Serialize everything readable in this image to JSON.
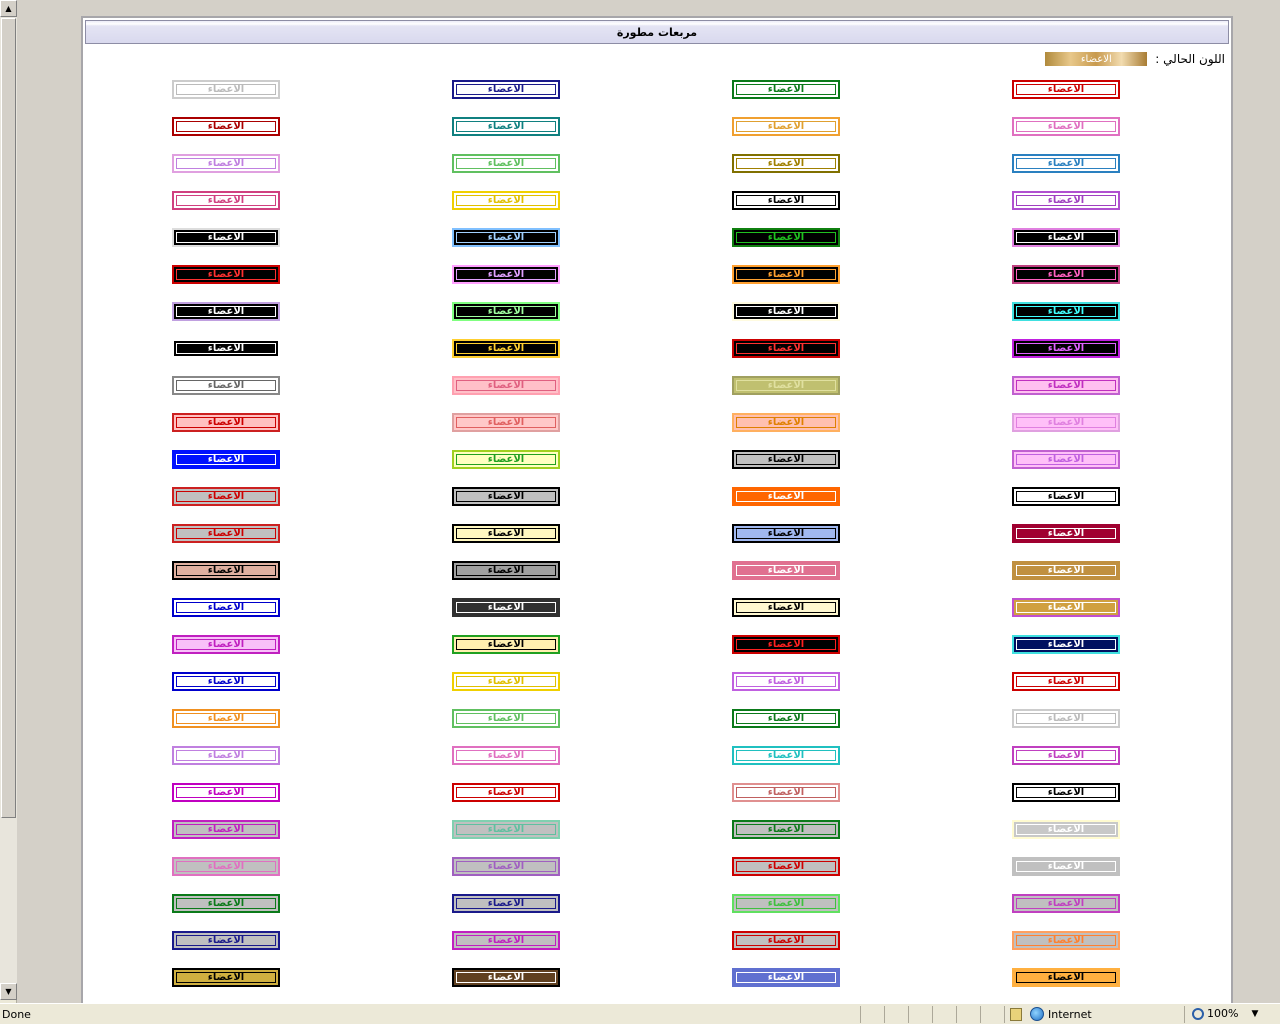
{
  "panel": {
    "title": "مربعات مطورة"
  },
  "current_color": {
    "label": "اللون الحالي :",
    "swatch_text": "الاعضاء"
  },
  "box_label": "الاعضاء",
  "columns_fg": [
    "#cc0000",
    "#0b7a1a",
    "#1a1a8a",
    "#bbbbbb"
  ],
  "rows": [
    [
      {
        "fg": "#cc0000",
        "bg": "#ffffff",
        "bd": "#cc0000"
      },
      {
        "fg": "#0b7a1a",
        "bg": "#ffffff",
        "bd": "#0b7a1a"
      },
      {
        "fg": "#1a1a8a",
        "bg": "#ffffff",
        "bd": "#1a1a8a"
      },
      {
        "fg": "#bbbbbb",
        "bg": "#ffffff",
        "bd": "#cccccc"
      }
    ],
    [
      {
        "fg": "#e070c0",
        "bg": "#ffffff",
        "bd": "#e070c0"
      },
      {
        "fg": "#e0a030",
        "bg": "#ffffff",
        "bd": "#f0a030"
      },
      {
        "fg": "#108080",
        "bg": "#ffffff",
        "bd": "#108080"
      },
      {
        "fg": "#aa0000",
        "bg": "#ffffff",
        "bd": "#aa0000"
      }
    ],
    [
      {
        "fg": "#2a80c0",
        "bg": "#ffffff",
        "bd": "#2a80c0"
      },
      {
        "fg": "#a08000",
        "bg": "#ffffff",
        "bd": "#807000"
      },
      {
        "fg": "#60c060",
        "bg": "#ffffff",
        "bd": "#60c060"
      },
      {
        "fg": "#c080e0",
        "bg": "#ffffff",
        "bd": "#e0a0e0"
      }
    ],
    [
      {
        "fg": "#a040c0",
        "bg": "#ffffff",
        "bd": "#b050d0"
      },
      {
        "fg": "#000000",
        "bg": "#ffffff",
        "bd": "#000000"
      },
      {
        "fg": "#e0c000",
        "bg": "#ffffff",
        "bd": "#f0d000"
      },
      {
        "fg": "#d04080",
        "bg": "#ffffff",
        "bd": "#d04080"
      }
    ],
    [
      {
        "fg": "#ffffff",
        "bg": "#000000",
        "bd": "#e080e0"
      },
      {
        "fg": "#20c020",
        "bg": "#000000",
        "bd": "#108010"
      },
      {
        "fg": "#a0d0ff",
        "bg": "#000000",
        "bd": "#80c0ff"
      },
      {
        "fg": "#ffffff",
        "bg": "#000000",
        "bd": "#dddddd"
      }
    ],
    [
      {
        "fg": "#ff60c0",
        "bg": "#000000",
        "bd": "#c04080"
      },
      {
        "fg": "#ffa030",
        "bg": "#000000",
        "bd": "#ffa030"
      },
      {
        "fg": "#e0a0ff",
        "bg": "#000000",
        "bd": "#ffa0ff"
      },
      {
        "fg": "#ff3030",
        "bg": "#000000",
        "bd": "#cc0000"
      }
    ],
    [
      {
        "fg": "#40ffff",
        "bg": "#000000",
        "bd": "#40e0e0"
      },
      {
        "fg": "#ffffff",
        "bg": "#000000",
        "bd": "#fffbe0"
      },
      {
        "fg": "#a0ffa0",
        "bg": "#000000",
        "bd": "#80ff80"
      },
      {
        "fg": "#ffffff",
        "bg": "#000000",
        "bd": "#c0a0e0"
      }
    ],
    [
      {
        "fg": "#e060ff",
        "bg": "#000000",
        "bd": "#c020e0"
      },
      {
        "fg": "#ff3030",
        "bg": "#000000",
        "bd": "#cc0000"
      },
      {
        "fg": "#ffd030",
        "bg": "#000000",
        "bd": "#ffd030"
      },
      {
        "fg": "#ffffff",
        "bg": "#000000",
        "bd": "#ffffff"
      }
    ],
    [
      {
        "fg": "#c030c0",
        "bg": "#ffc0f0",
        "bd": "#c060d0"
      },
      {
        "fg": "#e0e0a0",
        "bg": "#c0c070",
        "bd": "#a0a060"
      },
      {
        "fg": "#e06080",
        "bg": "#ffc0c8",
        "bd": "#ffa0b0"
      },
      {
        "fg": "#666666",
        "bg": "#ffffff",
        "bd": "#888888"
      }
    ],
    [
      {
        "fg": "#e080e0",
        "bg": "#ffc0f8",
        "bd": "#e0a0e0"
      },
      {
        "fg": "#e08000",
        "bg": "#ffc0b0",
        "bd": "#ffb060"
      },
      {
        "fg": "#e06060",
        "bg": "#ffc8c8",
        "bd": "#e0a0a0"
      },
      {
        "fg": "#cc0000",
        "bg": "#ffc0c0",
        "bd": "#cc2020"
      }
    ],
    [
      {
        "fg": "#c060e0",
        "bg": "#ffc0f8",
        "bd": "#c060d0"
      },
      {
        "fg": "#000000",
        "bg": "#c0c0c0",
        "bd": "#000000"
      },
      {
        "fg": "#20a020",
        "bg": "#ffffc0",
        "bd": "#a0d020"
      },
      {
        "fg": "#ffffff",
        "bg": "#0010ff",
        "bd": "#0010ff"
      }
    ],
    [
      {
        "fg": "#000000",
        "bg": "#ffffff",
        "bd": "#000000"
      },
      {
        "fg": "#ffffff",
        "bg": "#ff6600",
        "bd": "#ff6600"
      },
      {
        "fg": "#000000",
        "bg": "#c0c0c0",
        "bd": "#000000"
      },
      {
        "fg": "#cc0000",
        "bg": "#c0c0c0",
        "bd": "#cc2020"
      }
    ],
    [
      {
        "fg": "#ffffff",
        "bg": "#a00030",
        "bd": "#a00030"
      },
      {
        "fg": "#000000",
        "bg": "#a0b8f0",
        "bd": "#000000"
      },
      {
        "fg": "#000000",
        "bg": "#fff8c0",
        "bd": "#000000"
      },
      {
        "fg": "#cc0000",
        "bg": "#c0c0c0",
        "bd": "#cc2020"
      }
    ],
    [
      {
        "fg": "#ffffff",
        "bg": "#c09040",
        "bd": "#c09040"
      },
      {
        "fg": "#ffffff",
        "bg": "#e07090",
        "bd": "#e07090"
      },
      {
        "fg": "#000000",
        "bg": "#a0a0a0",
        "bd": "#000000"
      },
      {
        "fg": "#000000",
        "bg": "#e0b0a0",
        "bd": "#000000"
      }
    ],
    [
      {
        "fg": "#ffffff",
        "bg": "#d0a040",
        "bd": "#c050d0"
      },
      {
        "fg": "#000000",
        "bg": "#fff8d0",
        "bd": "#000000"
      },
      {
        "fg": "#ffffff",
        "bg": "#303030",
        "bd": "#303030"
      },
      {
        "fg": "#0000cc",
        "bg": "#ffffff",
        "bd": "#0000cc"
      }
    ],
    [
      {
        "fg": "#ffffff",
        "bg": "#001060",
        "bd": "#40e0e0"
      },
      {
        "fg": "#ff2020",
        "bg": "#000000",
        "bd": "#cc0000"
      },
      {
        "fg": "#000000",
        "bg": "#fff0b0",
        "bd": "#20a020"
      },
      {
        "fg": "#c020c0",
        "bg": "#f8c0f8",
        "bd": "#c020c0"
      }
    ],
    [
      {
        "fg": "#cc0000",
        "bg": "#ffffff",
        "bd": "#cc0000"
      },
      {
        "fg": "#c060e0",
        "bg": "#ffffff",
        "bd": "#c060e0"
      },
      {
        "fg": "#e0c000",
        "bg": "#ffffff",
        "bd": "#f0d000"
      },
      {
        "fg": "#0000cc",
        "bg": "#ffffff",
        "bd": "#0000cc"
      }
    ],
    [
      {
        "fg": "#bbbbbb",
        "bg": "#ffffff",
        "bd": "#cccccc"
      },
      {
        "fg": "#0b7a1a",
        "bg": "#ffffff",
        "bd": "#0b7a1a"
      },
      {
        "fg": "#60c060",
        "bg": "#ffffff",
        "bd": "#60c060"
      },
      {
        "fg": "#f09020",
        "bg": "#ffffff",
        "bd": "#f09020"
      }
    ],
    [
      {
        "fg": "#c040c0",
        "bg": "#ffffff",
        "bd": "#c040c0"
      },
      {
        "fg": "#20c0c0",
        "bg": "#ffffff",
        "bd": "#20c0c0"
      },
      {
        "fg": "#e070c0",
        "bg": "#ffffff",
        "bd": "#e070c0"
      },
      {
        "fg": "#c080e0",
        "bg": "#ffffff",
        "bd": "#c080e0"
      }
    ],
    [
      {
        "fg": "#000000",
        "bg": "#ffffff",
        "bd": "#000000"
      },
      {
        "fg": "#c06060",
        "bg": "#ffffff",
        "bd": "#e09090"
      },
      {
        "fg": "#cc0000",
        "bg": "#ffffff",
        "bd": "#cc0000"
      },
      {
        "fg": "#c000c0",
        "bg": "#ffffff",
        "bd": "#c000c0"
      }
    ],
    [
      {
        "fg": "#ffffff",
        "bg": "#c8c8c8",
        "bd": "#fffbd0"
      },
      {
        "fg": "#0b7a1a",
        "bg": "#c0c0c0",
        "bd": "#0b7a1a"
      },
      {
        "fg": "#60c0a0",
        "bg": "#c0c0c0",
        "bd": "#80d0b0"
      },
      {
        "fg": "#c020c0",
        "bg": "#c0c0c0",
        "bd": "#c020c0"
      }
    ],
    [
      {
        "fg": "#ffffff",
        "bg": "#c0c0c0",
        "bd": "#c0c0c0"
      },
      {
        "fg": "#cc0000",
        "bg": "#c0c0c0",
        "bd": "#cc0000"
      },
      {
        "fg": "#a060c0",
        "bg": "#c0c0c0",
        "bd": "#a060c0"
      },
      {
        "fg": "#e070c0",
        "bg": "#c0c0c0",
        "bd": "#e070c0"
      }
    ],
    [
      {
        "fg": "#c040c0",
        "bg": "#c0c0c0",
        "bd": "#c040c0"
      },
      {
        "fg": "#40c040",
        "bg": "#c0c0c0",
        "bd": "#60e060"
      },
      {
        "fg": "#1a1a8a",
        "bg": "#c0c0c0",
        "bd": "#1a1a8a"
      },
      {
        "fg": "#0b7a1a",
        "bg": "#c0c0c0",
        "bd": "#0b7a1a"
      }
    ],
    [
      {
        "fg": "#ff8030",
        "bg": "#c0c0c0",
        "bd": "#ffa060"
      },
      {
        "fg": "#cc0000",
        "bg": "#c0c0c0",
        "bd": "#cc0000"
      },
      {
        "fg": "#c020c0",
        "bg": "#c0c0c0",
        "bd": "#c020c0"
      },
      {
        "fg": "#1a1a8a",
        "bg": "#c0c0c0",
        "bd": "#1a1a8a"
      }
    ],
    [
      {
        "fg": "#000000",
        "bg": "#ffb040",
        "bd": "#ffb040"
      },
      {
        "fg": "#ffffff",
        "bg": "#6070d0",
        "bd": "#6070d0"
      },
      {
        "fg": "#ffffff",
        "bg": "#604020",
        "bd": "#000000"
      },
      {
        "fg": "#000000",
        "bg": "#d0b040",
        "bd": "#000000"
      }
    ]
  ],
  "status": {
    "text": "Done",
    "zone": "Internet",
    "zoom": "100%"
  }
}
